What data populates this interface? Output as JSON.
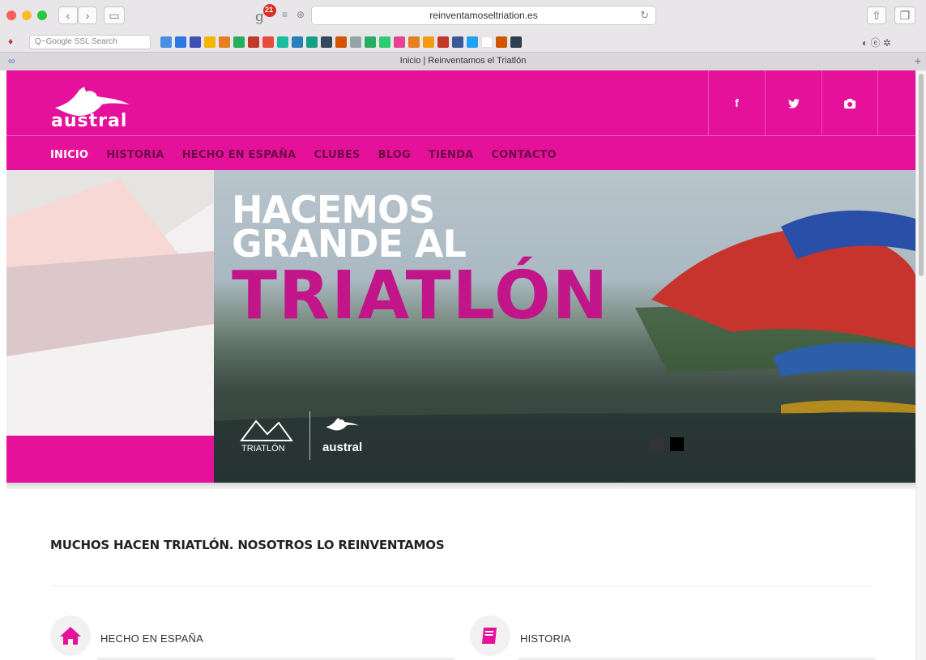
{
  "browser": {
    "url": "reinventamoseltriation.es",
    "tab_title": "Inicio | Reinventamos el Triatlón",
    "search_placeholder": "Q~Google SSL Search",
    "ext_badge_count": "21"
  },
  "site": {
    "logo_text": "austral",
    "social": [
      {
        "label": "f",
        "icon": "facebook-icon"
      },
      {
        "label": "twitter",
        "icon": "twitter-icon"
      },
      {
        "label": "camera",
        "icon": "camera-icon"
      }
    ],
    "nav": [
      {
        "label": "INICIO",
        "active": true
      },
      {
        "label": "HISTORIA",
        "active": false
      },
      {
        "label": "HECHO EN ESPAÑA",
        "active": false
      },
      {
        "label": "CLUBES",
        "active": false
      },
      {
        "label": "BLOG",
        "active": false
      },
      {
        "label": "TIENDA",
        "active": false
      },
      {
        "label": "CONTACTO",
        "active": false
      }
    ]
  },
  "hero": {
    "line1": "HACEMOS",
    "line2": "GRANDE AL",
    "line3": "TRIATLÓN",
    "fed_logo_text": "TRIATLÓN",
    "austral_logo_text": "austral"
  },
  "content": {
    "section_title": "MUCHOS HACEN TRIATLÓN. NOSOTROS LO REINVENTAMOS",
    "features": [
      {
        "label": "HECHO EN ESPAÑA",
        "icon": "home-icon"
      },
      {
        "label": "HISTORIA",
        "icon": "book-icon"
      }
    ]
  },
  "colors": {
    "brand_pink": "#e5119a",
    "nav_inactive": "#6b0a45"
  }
}
